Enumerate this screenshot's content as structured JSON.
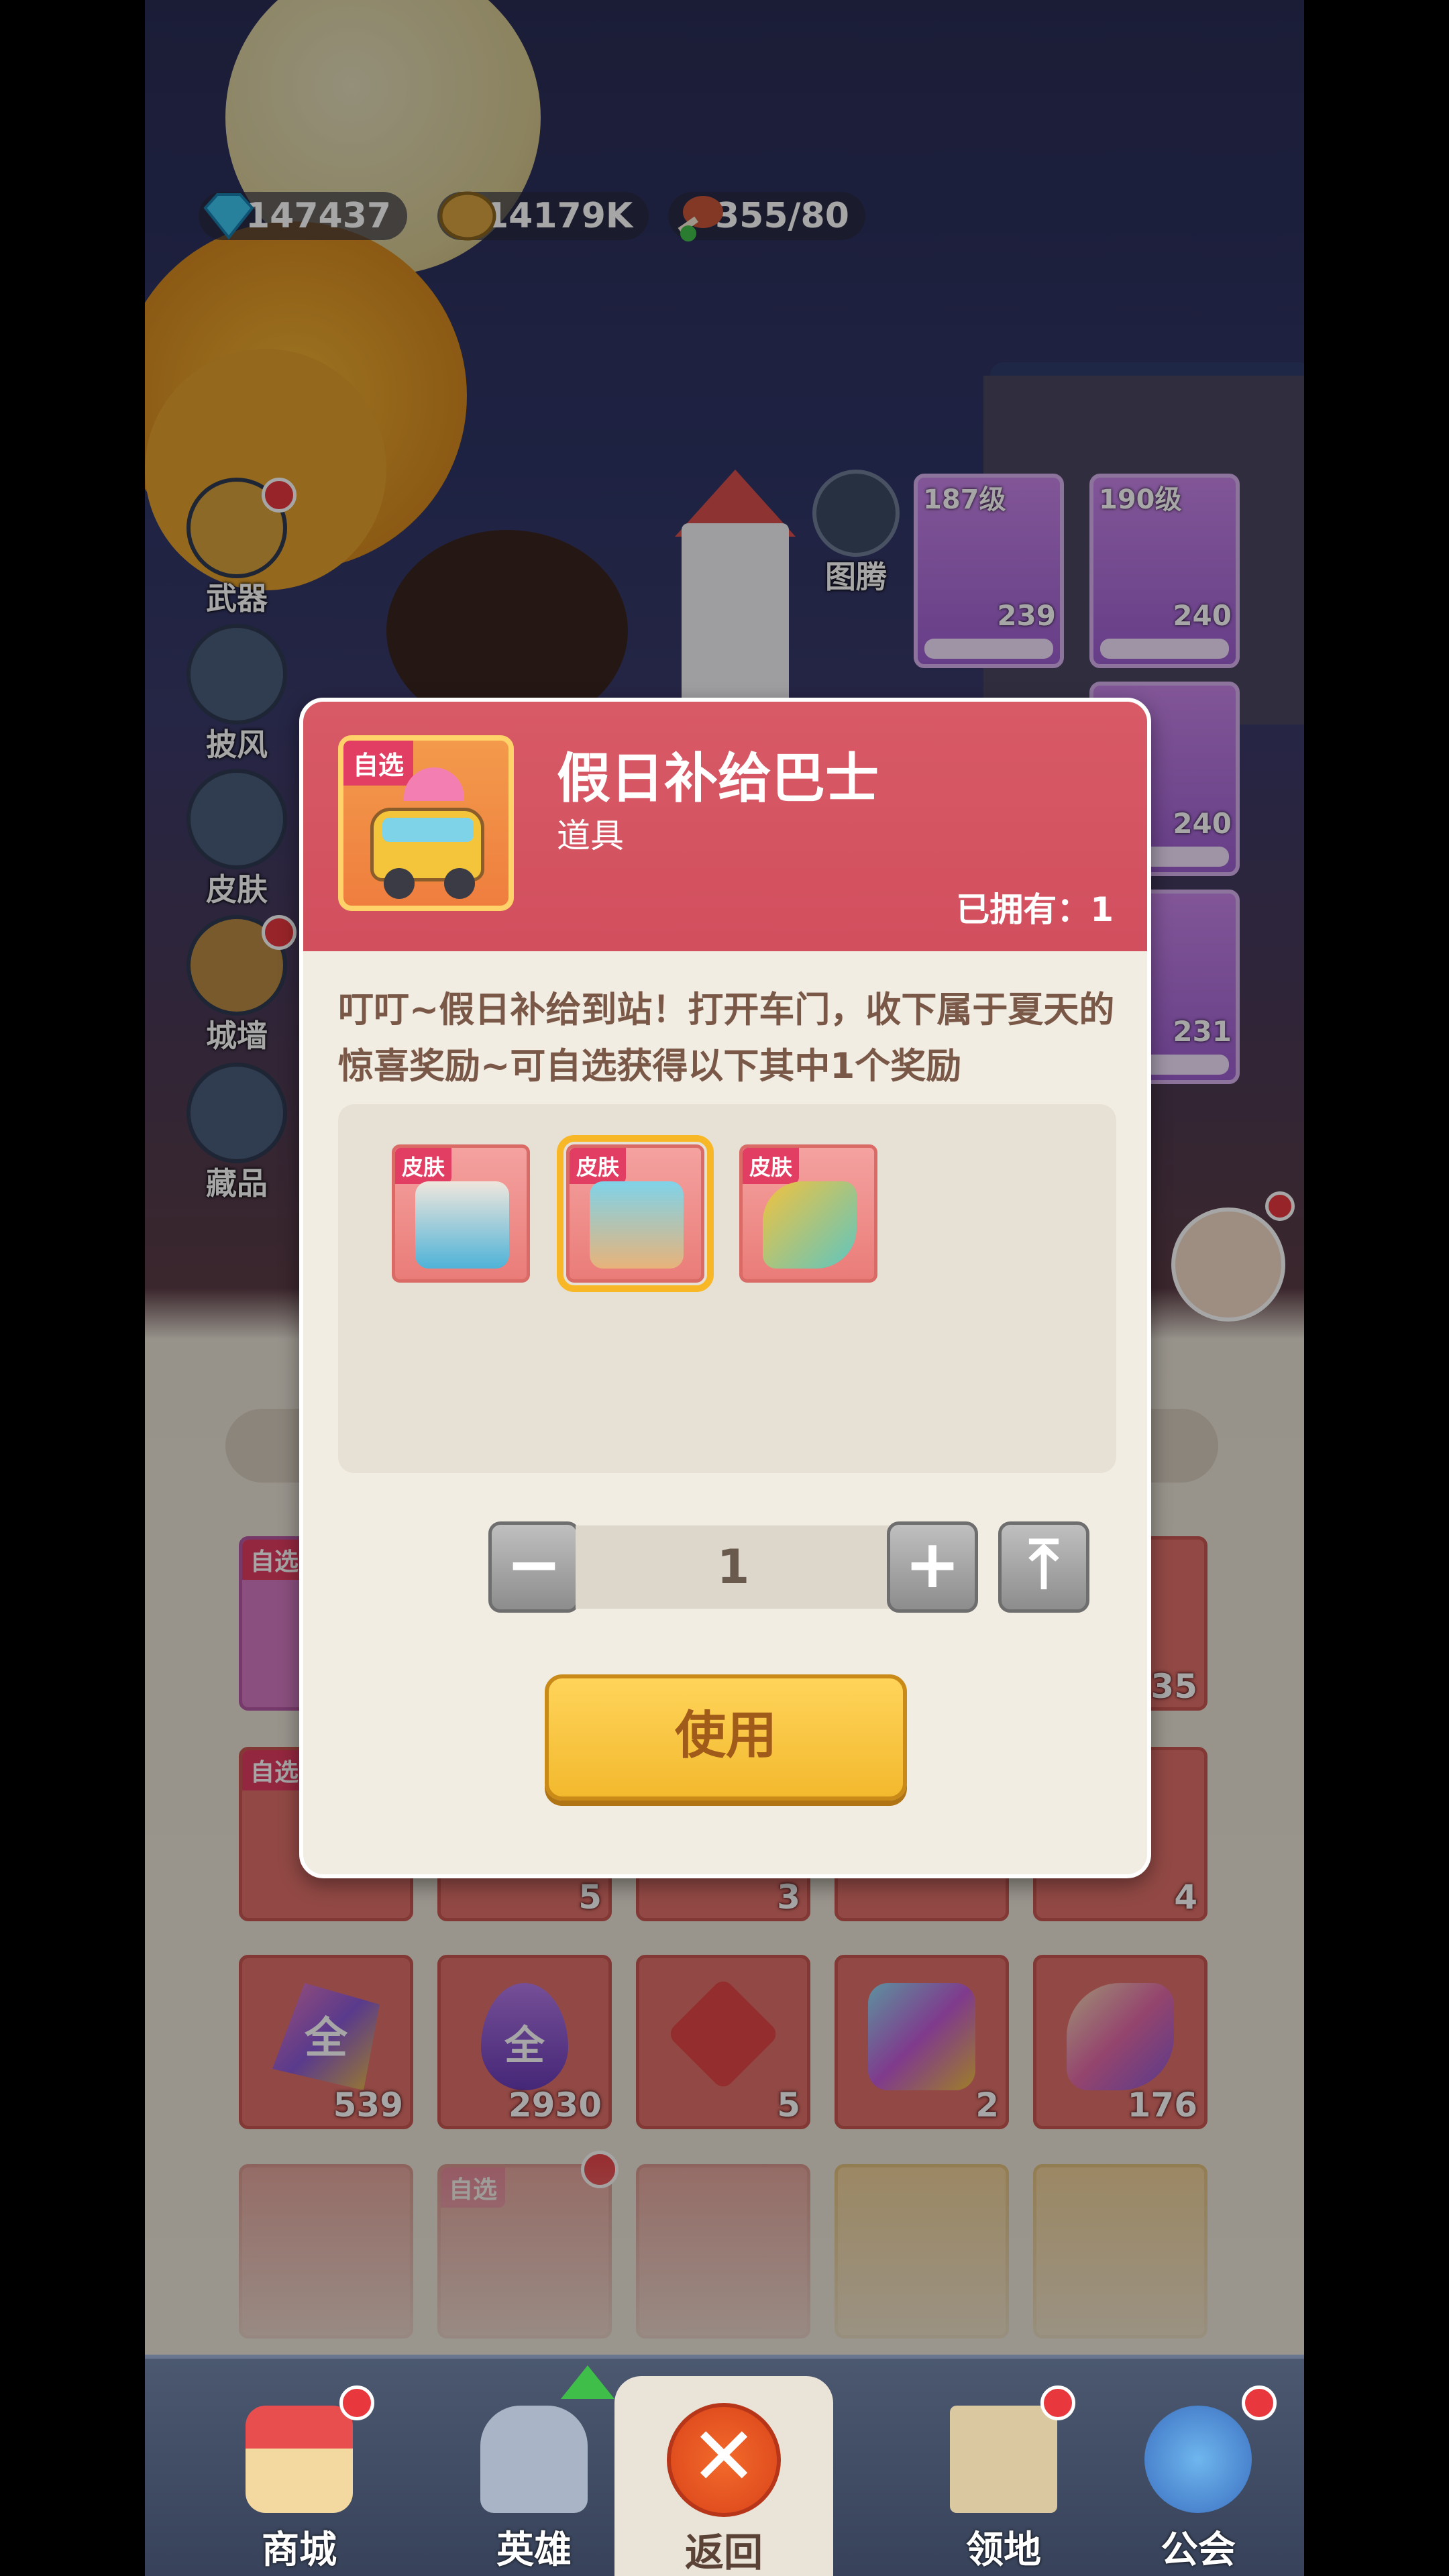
{
  "resources": {
    "diamonds": "147437",
    "coins": "14179K",
    "stamina": "355/80"
  },
  "side_menu": [
    {
      "label": "武器"
    },
    {
      "label": "披风"
    },
    {
      "label": "皮肤"
    },
    {
      "label": "城墙"
    },
    {
      "label": "藏品"
    }
  ],
  "totem_label": "图腾",
  "hero_cards": [
    {
      "level": "187级",
      "count": "239"
    },
    {
      "level": "190级",
      "count": "240"
    },
    {
      "level": "",
      "count": "240"
    },
    {
      "level": "",
      "count": "231"
    }
  ],
  "inventory": {
    "tag": "自选",
    "row1_counts": [
      "",
      "",
      "",
      "",
      "35"
    ],
    "row2_counts": [
      "",
      "5",
      "3",
      "",
      "4"
    ],
    "row3_counts": [
      "539",
      "2930",
      "5",
      "2",
      "176"
    ],
    "gem_symbol": "全"
  },
  "modal": {
    "icon_tag": "自选",
    "title": "假日补给巴士",
    "subtitle": "道具",
    "owned": "已拥有：1",
    "description": "叮叮~假日补给到站！打开车门，收下属于夏天的惊喜奖励~可自选获得以下其中1个奖励",
    "rewards": [
      {
        "tag": "皮肤",
        "selected": false
      },
      {
        "tag": "皮肤",
        "selected": true
      },
      {
        "tag": "皮肤",
        "selected": false
      }
    ],
    "quantity": "1",
    "minus": "−",
    "plus": "+",
    "max": "⤒",
    "use_label": "使用"
  },
  "bottom_nav": {
    "shop": "商城",
    "heroes": "英雄",
    "back": "返回",
    "territory": "领地",
    "guild": "公会",
    "close_symbol": "✕"
  },
  "colors": {
    "header_red": "#d85a66",
    "use_button": "#f3b92e",
    "badge_red": "#e8383e"
  }
}
